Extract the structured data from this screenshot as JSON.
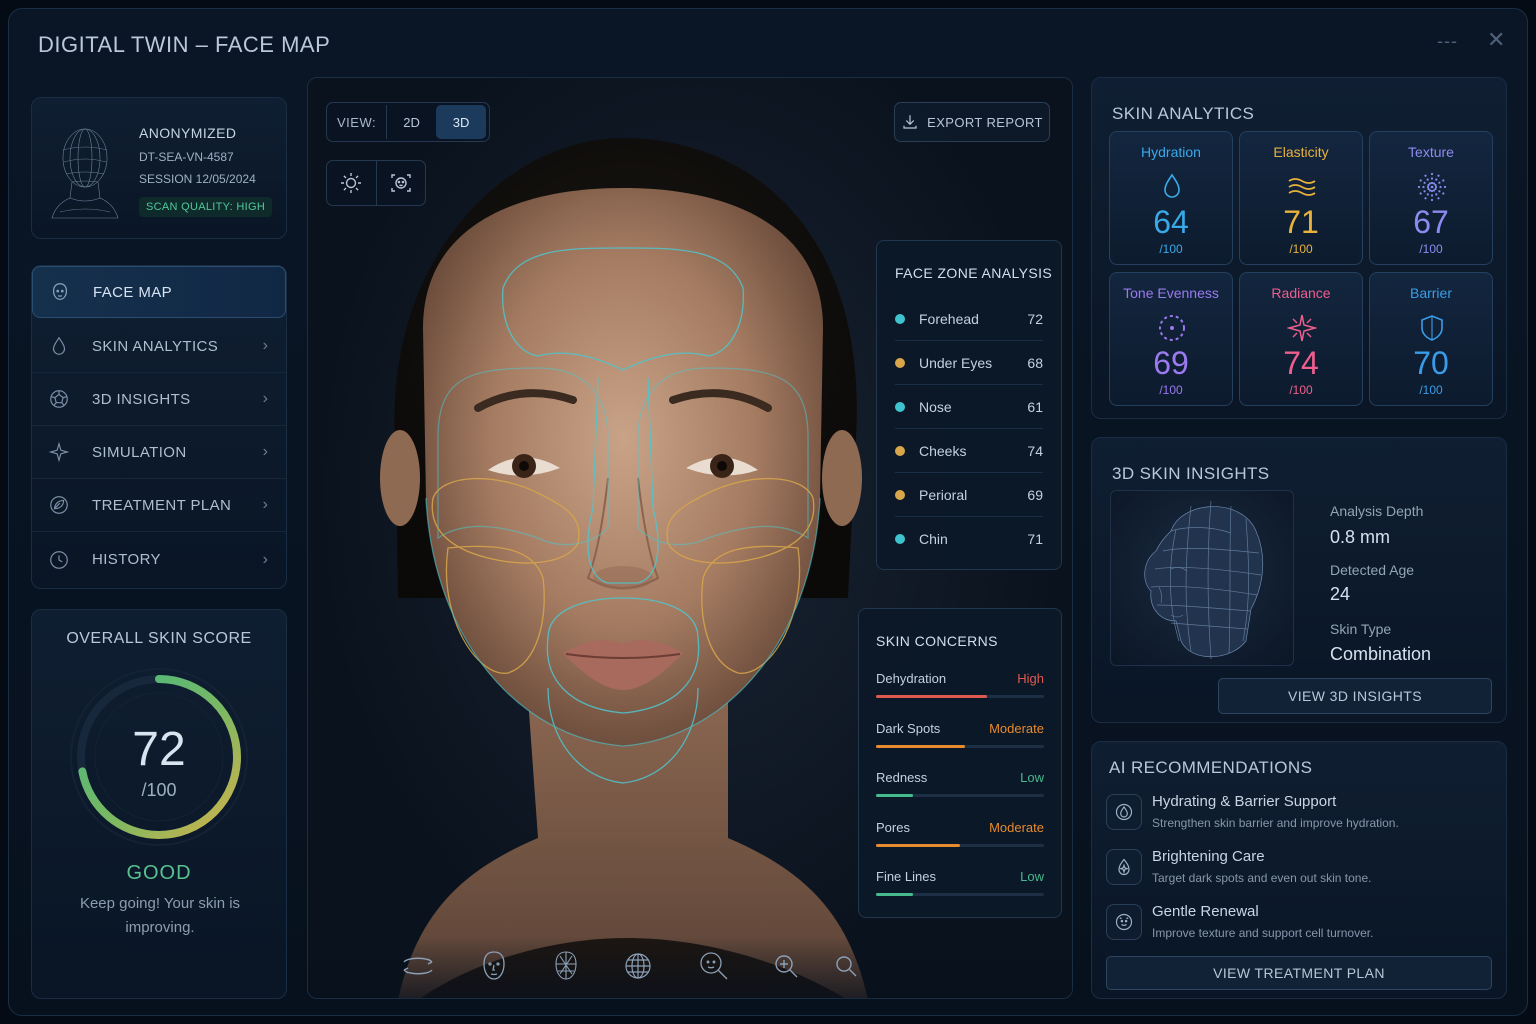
{
  "window": {
    "title": "DIGITAL TWIN – FACE MAP",
    "minimize": "---",
    "close": "✕"
  },
  "profile": {
    "name": "ANONYMIZED",
    "id": "DT-SEA-VN-4587",
    "session": "SESSION 12/05/2024",
    "quality": "SCAN QUALITY: HIGH",
    "icon": "wireframe-head-icon"
  },
  "nav": {
    "items": [
      {
        "label": "FACE MAP",
        "icon": "face-icon",
        "active": true
      },
      {
        "label": "SKIN ANALYTICS",
        "icon": "drop-icon"
      },
      {
        "label": "3D INSIGHTS",
        "icon": "dodecahedron-icon"
      },
      {
        "label": "SIMULATION",
        "icon": "sparkle-icon"
      },
      {
        "label": "TREATMENT PLAN",
        "icon": "leaf-icon"
      },
      {
        "label": "HISTORY",
        "icon": "clock-icon"
      }
    ],
    "chevron": "›"
  },
  "score": {
    "title": "OVERALL SKIN SCORE",
    "value": "72",
    "max": "/100",
    "fraction": 0.72,
    "rating": "GOOD",
    "message": "Keep going! Your skin is improving.",
    "colors": {
      "start": "#d5b24a",
      "end": "#3fb884",
      "track": "#17283c"
    }
  },
  "viewer": {
    "view_label": "VIEW:",
    "views": [
      "2D",
      "3D"
    ],
    "selected_view": "3D",
    "tools": [
      "brightness-icon",
      "face-scan-icon"
    ],
    "export_label": "EXPORT REPORT",
    "export_icon": "download-icon",
    "bottom_tools": [
      "rotate-icon",
      "face-front-icon",
      "face-mesh-icon",
      "globe-grid-icon",
      "face-zoom-icon",
      "zoom-in-icon",
      "search-icon"
    ]
  },
  "face_zones": {
    "title": "FACE ZONE ANALYSIS",
    "zones": [
      {
        "name": "Forehead",
        "score": "72",
        "color": "#3fc4cf"
      },
      {
        "name": "Under Eyes",
        "score": "68",
        "color": "#d9a74a"
      },
      {
        "name": "Nose",
        "score": "61",
        "color": "#3fc4cf"
      },
      {
        "name": "Cheeks",
        "score": "74",
        "color": "#d9a74a"
      },
      {
        "name": "Perioral",
        "score": "69",
        "color": "#d9a74a"
      },
      {
        "name": "Chin",
        "score": "71",
        "color": "#3fc4cf"
      }
    ]
  },
  "concerns": {
    "title": "SKIN CONCERNS",
    "items": [
      {
        "name": "Dehydration",
        "level": "High",
        "level_color": "#e0594f",
        "fill": 0.66
      },
      {
        "name": "Dark Spots",
        "level": "Moderate",
        "level_color": "#e88a2e",
        "fill": 0.53
      },
      {
        "name": "Redness",
        "level": "Low",
        "level_color": "#46b98e",
        "fill": 0.22
      },
      {
        "name": "Pores",
        "level": "Moderate",
        "level_color": "#e88a2e",
        "fill": 0.5
      },
      {
        "name": "Fine Lines",
        "level": "Low",
        "level_color": "#46b98e",
        "fill": 0.22
      }
    ]
  },
  "skin_analytics": {
    "title": "SKIN ANALYTICS",
    "metrics": [
      {
        "name": "Hydration",
        "value": "64",
        "max": "/100",
        "color": "#3aa9e8",
        "icon": "drop-icon"
      },
      {
        "name": "Elasticity",
        "value": "71",
        "max": "/100",
        "color": "#e8b23c",
        "icon": "waves-icon"
      },
      {
        "name": "Texture",
        "value": "67",
        "max": "/100",
        "color": "#8d8bf0",
        "icon": "dots-icon"
      },
      {
        "name": "Tone Evenness",
        "value": "69",
        "max": "/100",
        "color": "#9b79ef",
        "icon": "dashed-circle-icon"
      },
      {
        "name": "Radiance",
        "value": "74",
        "max": "/100",
        "color": "#ef5f8d",
        "icon": "star-burst-icon"
      },
      {
        "name": "Barrier",
        "value": "70",
        "max": "/100",
        "color": "#3a9ce8",
        "icon": "shield-icon"
      }
    ]
  },
  "insights": {
    "title": "3D SKIN INSIGHTS",
    "depth_label": "Analysis Depth",
    "depth_value": "0.8 mm",
    "age_label": "Detected Age",
    "age_value": "24",
    "type_label": "Skin Type",
    "type_value": "Combination",
    "button": "VIEW 3D INSIGHTS"
  },
  "recommendations": {
    "title": "AI RECOMMENDATIONS",
    "items": [
      {
        "title": "Hydrating & Barrier Support",
        "desc": "Strengthen skin barrier and improve hydration.",
        "icon": "barrier-icon"
      },
      {
        "title": "Brightening Care",
        "desc": "Target dark spots and even out skin tone.",
        "icon": "brightening-icon"
      },
      {
        "title": "Gentle Renewal",
        "desc": "Improve texture and support cell turnover.",
        "icon": "renewal-icon"
      }
    ],
    "button": "VIEW TREATMENT PLAN"
  }
}
